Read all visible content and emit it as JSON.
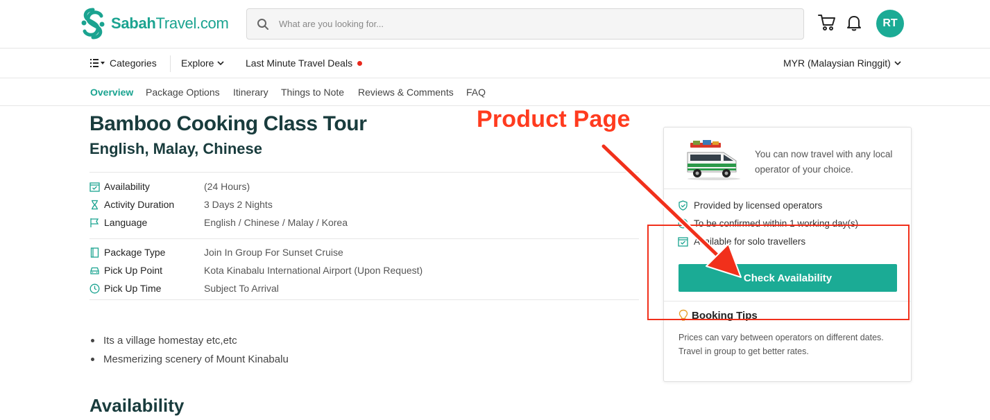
{
  "header": {
    "logo_text_bold": "Sabah",
    "logo_text_light": "Travel.com",
    "search_placeholder": "What are you looking for...",
    "avatar_initials": "RT",
    "brand_color": "#1aa390"
  },
  "nav": {
    "categories": "Categories",
    "explore": "Explore",
    "deals": "Last Minute Travel Deals",
    "currency": "MYR (Malaysian Ringgit)"
  },
  "subnav": {
    "items": [
      "Overview",
      "Package Options",
      "Itinerary",
      "Things to Note",
      "Reviews & Comments",
      "FAQ"
    ]
  },
  "product": {
    "title": "Bamboo Cooking Class Tour",
    "subtitle": "English, Malay, Chinese",
    "details": [
      {
        "label": "Availability",
        "value": "(24 Hours)"
      },
      {
        "label": "Activity Duration",
        "value": "3 Days 2 Nights"
      },
      {
        "label": "Language",
        "value": "English / Chinese / Malay / Korea"
      },
      {
        "label": "Package Type",
        "value": "Join In Group For Sunset Cruise"
      },
      {
        "label": "Pick Up Point",
        "value": "Kota Kinabalu International Airport (Upon Request)"
      },
      {
        "label": "Pick Up Time",
        "value": "Subject To Arrival"
      }
    ],
    "highlights": [
      "Its a village homestay etc,etc",
      "Mesmerizing scenery of Mount Kinabalu"
    ],
    "availability_heading": "Availability"
  },
  "card": {
    "message": "You can now travel with any local operator of your choice.",
    "features": [
      "Provided by licensed operators",
      "To be confirmed within 1 working day(s)",
      "Available for solo travellers"
    ],
    "button": "Check Availability",
    "tips_title": "Booking Tips",
    "tips_line1": "Prices can vary between operators on different dates.",
    "tips_line2": "Travel in group to get better rates."
  },
  "annotation": {
    "label": "Product Page"
  }
}
